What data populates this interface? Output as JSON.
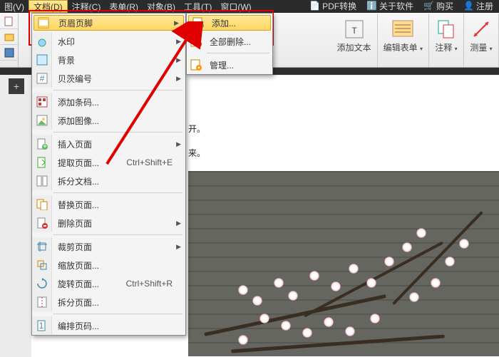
{
  "menubar": {
    "items": [
      {
        "label": "图(V)"
      },
      {
        "label": "文档(D)"
      },
      {
        "label": "注释(C)"
      },
      {
        "label": "表单(R)"
      },
      {
        "label": "对象(B)"
      },
      {
        "label": "工具(T)"
      },
      {
        "label": "窗口(W)"
      }
    ]
  },
  "top_right": {
    "convert": "PDF转换",
    "about": "关于软件",
    "buy": "购买",
    "register": "注册"
  },
  "toolbar": {
    "add_text": "添加文本",
    "edit_form": "编辑表单",
    "annotate": "注释",
    "measure": "测量"
  },
  "dropdown": {
    "header_footer": "页眉页脚",
    "watermark": "水印",
    "background": "背景",
    "bates": "贝茨编号",
    "barcode": "添加条码...",
    "image": "添加图像...",
    "insert_pages": "插入页面",
    "extract_pages": "提取页面...",
    "extract_accel": "Ctrl+Shift+E",
    "split_doc": "拆分文档...",
    "replace_pages": "替换页面...",
    "delete_pages": "删除页面",
    "crop_pages": "裁剪页面",
    "resize_pages": "缩放页面...",
    "rotate_pages": "旋转页面...",
    "rotate_accel": "Ctrl+Shift+R",
    "split_pages": "拆分页面...",
    "page_numbering": "编排页码..."
  },
  "submenu": {
    "add": "添加...",
    "remove_all": "全部删除...",
    "manage": "管理..."
  },
  "content": {
    "line1": "开。",
    "line2": "来。"
  }
}
